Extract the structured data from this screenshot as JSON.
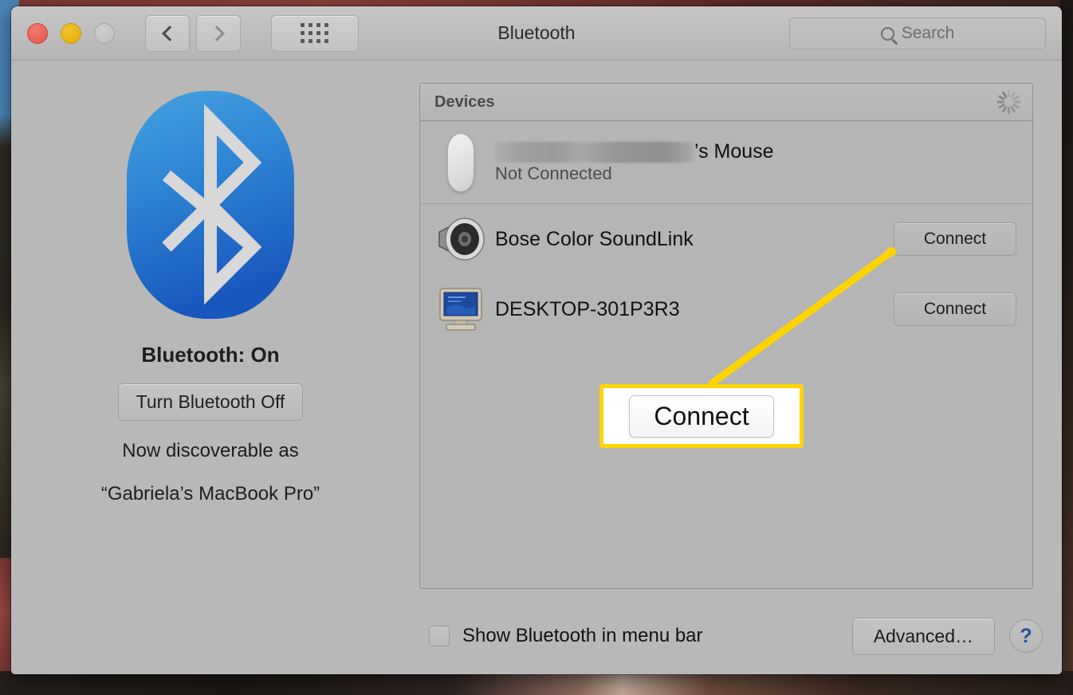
{
  "window": {
    "title": "Bluetooth",
    "traffic_lights": [
      {
        "name": "close",
        "color": "#e0574c"
      },
      {
        "name": "minimize",
        "color": "#e3aa07"
      },
      {
        "name": "zoom",
        "color": "#bdbdbd"
      }
    ],
    "toolbar": {
      "back_icon": "chevron-left-icon",
      "forward_icon": "chevron-right-icon",
      "show_all_icon": "grid-dots-icon"
    },
    "search": {
      "placeholder": "Search",
      "value": "",
      "icon": "search-icon"
    }
  },
  "left_pane": {
    "logo_icon": "bluetooth-logo-icon",
    "logo_gradient_top": "#3f9ddd",
    "logo_gradient_bottom": "#1a5fc2",
    "status": "Bluetooth: On",
    "toggle_label": "Turn Bluetooth Off",
    "discoverable_text": "Now discoverable as",
    "discoverable_name": "“Gabriela’s MacBook Pro”"
  },
  "devices_panel": {
    "header_label": "Devices",
    "scanning_icon": "spinner-icon",
    "rows": [
      {
        "icon": "magic-mouse-icon",
        "name_redacted": true,
        "name_suffix": "’s Mouse",
        "status": "Not Connected",
        "action": null
      },
      {
        "icon": "speaker-icon",
        "name": "Bose Color SoundLink",
        "status": "",
        "action": "Connect"
      },
      {
        "icon": "desktop-computer-icon",
        "name": "DESKTOP-301P3R3",
        "status": "",
        "action": "Connect"
      }
    ]
  },
  "footer": {
    "checkbox_label": "Show Bluetooth in menu bar",
    "checkbox_checked": false,
    "advanced_label": "Advanced…",
    "help_label": "?"
  },
  "annotation": {
    "callout_label": "Connect",
    "highlight_color": "#ffd400",
    "target": "connect-button-bose-color-soundlink"
  }
}
